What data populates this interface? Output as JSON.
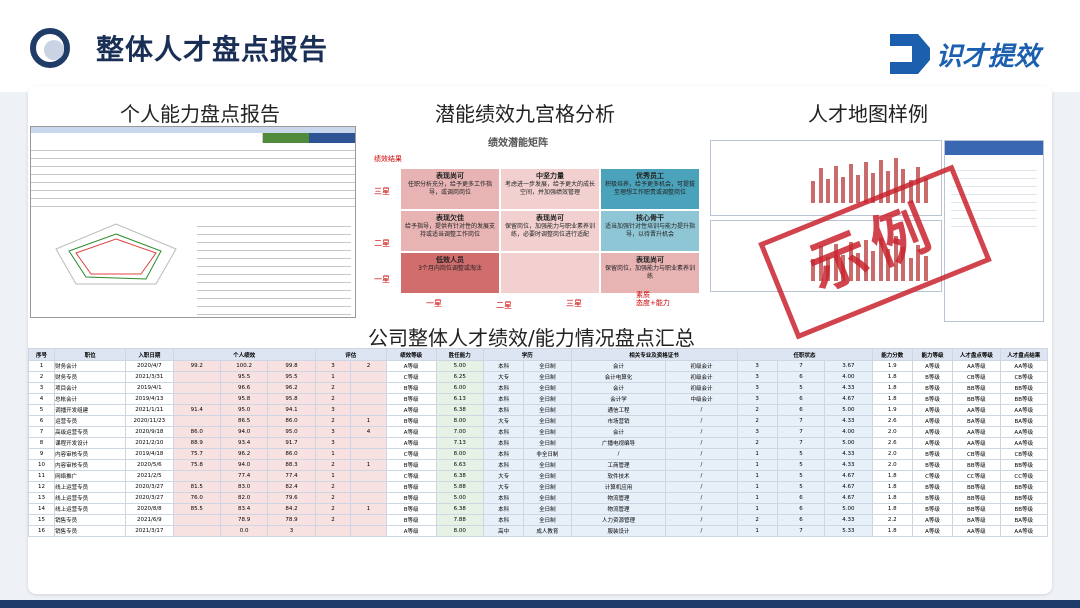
{
  "header": {
    "title": "整体人才盘点报告",
    "brand_name": "识才提效"
  },
  "sections": {
    "personal": "个人能力盘点报告",
    "ninegrid": "潜能绩效九宫格分析",
    "talentmap": "人才地图样例",
    "summary": "公司整体人才绩效/能力情况盘点汇总"
  },
  "stamp": "示例",
  "ninegrid": {
    "matrix_title": "绩效潜能矩阵",
    "y_axis": "绩效结果",
    "x_axis": "态度+能力",
    "x_axis_prefix": "素质",
    "y_ticks": [
      "三星",
      "二星",
      "一星"
    ],
    "x_ticks": [
      "一星",
      "二星",
      "三星"
    ],
    "cells": [
      {
        "title": "表现尚可",
        "text": "任职分析充分，给予更多工作指导，或调岗岗位",
        "color": "#e7b3b3"
      },
      {
        "title": "中坚力量",
        "text": "考虑进一步发展，给予更大的成长空间，并加强绩效管理",
        "color": "#f2d0d0"
      },
      {
        "title": "优秀员工",
        "text": "积极培养，给予更多机会，可提拔至理想工作职责或调整岗位",
        "color": "#4aa3ba"
      },
      {
        "title": "表现欠佳",
        "text": "给予指导，提供有针对性的发展支持或适当调整工作岗位",
        "color": "#e7b3b3"
      },
      {
        "title": "表现尚可",
        "text": "保留岗位，加强能力与职业素养训练，必要时调整岗位进行适配",
        "color": "#f2d0d0"
      },
      {
        "title": "核心骨干",
        "text": "适当加强针对性培训与能力提升指导，以待晋升机会",
        "color": "#8fc6d6"
      },
      {
        "title": "低效人员",
        "text": "3个月内岗位调整或淘汰",
        "color": "#d16d6d"
      },
      {
        "title": "",
        "text": "",
        "color": "#f2d0d0"
      },
      {
        "title": "表现尚可",
        "text": "保留岗位，加强能力与职业素养训练",
        "color": "#e7b3b3"
      }
    ]
  },
  "table": {
    "header_groups": [
      "序号",
      "职位",
      "入职日期",
      "个人绩效",
      "评估",
      "绩效等级",
      "绩效评分",
      "胜任能力",
      "同岗位工作经验",
      "学历",
      "相关专业及资格证书",
      "任职状态",
      "能力分数",
      "能力等级",
      "人才盘点等级",
      "人才盘点结果"
    ],
    "rows": [
      [
        "1",
        "财务会计",
        "2020/4/7",
        "99.2",
        "100.2",
        "99.8",
        "3",
        "2",
        "A等级",
        "5.00",
        "本科",
        "全日制",
        "会计",
        "初级会计",
        "3",
        "7",
        "3.67",
        "1.9",
        "A等级",
        "AA等级",
        "AA等级"
      ],
      [
        "2",
        "财务专员",
        "2021/3/31",
        "",
        "95.5",
        "95.5",
        "1",
        "",
        "C等级",
        "6.25",
        "大专",
        "全日制",
        "会计电算化",
        "初级会计",
        "3",
        "6",
        "4.00",
        "1.8",
        "B等级",
        "CB等级",
        "CB等级"
      ],
      [
        "3",
        "项目会计",
        "2019/4/1",
        "",
        "96.6",
        "96.2",
        "2",
        "",
        "B等级",
        "6.00",
        "本科",
        "全日制",
        "会计",
        "初级会计",
        "3",
        "5",
        "4.33",
        "1.8",
        "B等级",
        "BB等级",
        "BB等级"
      ],
      [
        "4",
        "总帐会计",
        "2019/4/13",
        "",
        "95.8",
        "95.8",
        "2",
        "",
        "B等级",
        "6.13",
        "本科",
        "全日制",
        "会计学",
        "中级会计",
        "3",
        "6",
        "4.67",
        "1.8",
        "B等级",
        "BB等级",
        "BB等级"
      ],
      [
        "5",
        "调播开发组建",
        "2021/1/11",
        "91.4",
        "95.0",
        "94.1",
        "3",
        "",
        "A等级",
        "6.38",
        "本科",
        "全日制",
        "通信工程",
        "/",
        "2",
        "6",
        "5.00",
        "1.9",
        "A等级",
        "AA等级",
        "AA等级"
      ],
      [
        "6",
        "运营专员",
        "2020/11/23",
        "",
        "86.5",
        "86.0",
        "2",
        "1",
        "B等级",
        "8.00",
        "大专",
        "全日制",
        "市场营销",
        "/",
        "2",
        "7",
        "4.33",
        "2.6",
        "A等级",
        "BA等级",
        "BA等级"
      ],
      [
        "7",
        "高级运营专员",
        "2020/9/18",
        "86.0",
        "94.0",
        "95.0",
        "3",
        "4",
        "A等级",
        "7.00",
        "本科",
        "全日制",
        "会计",
        "/",
        "3",
        "7",
        "4.00",
        "2.0",
        "A等级",
        "AA等级",
        "AA等级"
      ],
      [
        "8",
        "课程开发设计",
        "2021/2/10",
        "88.9",
        "93.4",
        "91.7",
        "3",
        "",
        "A等级",
        "7.13",
        "本科",
        "全日制",
        "广播电视编导",
        "/",
        "2",
        "7",
        "5.00",
        "2.6",
        "A等级",
        "AA等级",
        "AA等级"
      ],
      [
        "9",
        "内容审核专员",
        "2019/4/18",
        "75.7",
        "96.2",
        "86.0",
        "1",
        "",
        "C等级",
        "8.00",
        "本科",
        "非全日制",
        "/",
        "/",
        "1",
        "5",
        "4.33",
        "2.0",
        "B等级",
        "CB等级",
        "CB等级"
      ],
      [
        "10",
        "内容审核专员",
        "2020/5/6",
        "75.8",
        "94.0",
        "88.3",
        "2",
        "1",
        "B等级",
        "6.63",
        "本科",
        "全日制",
        "工商管理",
        "/",
        "1",
        "5",
        "4.33",
        "2.0",
        "B等级",
        "BB等级",
        "BB等级"
      ],
      [
        "11",
        "网络推广",
        "2021/2/5",
        "",
        "77.4",
        "77.4",
        "1",
        "",
        "C等级",
        "6.38",
        "大专",
        "全日制",
        "软件技术",
        "/",
        "1",
        "5",
        "4.67",
        "1.8",
        "C等级",
        "CC等级",
        "CC等级"
      ],
      [
        "12",
        "线上运营专员",
        "2020/3/27",
        "81.5",
        "83.0",
        "82.4",
        "2",
        "",
        "B等级",
        "5.88",
        "大专",
        "全日制",
        "计算机应用",
        "/",
        "1",
        "5",
        "4.67",
        "1.8",
        "B等级",
        "BB等级",
        "BB等级"
      ],
      [
        "13",
        "线上运营专员",
        "2020/3/27",
        "76.0",
        "82.0",
        "79.6",
        "2",
        "",
        "B等级",
        "5.00",
        "本科",
        "全日制",
        "物流管理",
        "/",
        "1",
        "6",
        "4.67",
        "1.8",
        "B等级",
        "BB等级",
        "BB等级"
      ],
      [
        "14",
        "线上运营专员",
        "2020/8/8",
        "85.5",
        "83.4",
        "84.2",
        "2",
        "1",
        "B等级",
        "6.38",
        "本科",
        "全日制",
        "物流管理",
        "/",
        "1",
        "6",
        "5.00",
        "1.8",
        "B等级",
        "BB等级",
        "BB等级"
      ],
      [
        "15",
        "销售专员",
        "2021/6/9",
        "",
        "78.9",
        "78.9",
        "2",
        "",
        "B等级",
        "7.88",
        "本科",
        "全日制",
        "人力资源管理",
        "/",
        "2",
        "6",
        "4.33",
        "2.2",
        "A等级",
        "BA等级",
        "BA等级"
      ],
      [
        "16",
        "销售专员",
        "2021/3/17",
        "",
        "0.0",
        "3",
        "",
        "",
        "A等级",
        "8.00",
        "高中",
        "成人教育",
        "服装设计",
        "/",
        "1",
        "7",
        "5.33",
        "1.8",
        "A等级",
        "AA等级",
        "AA等级"
      ]
    ]
  }
}
